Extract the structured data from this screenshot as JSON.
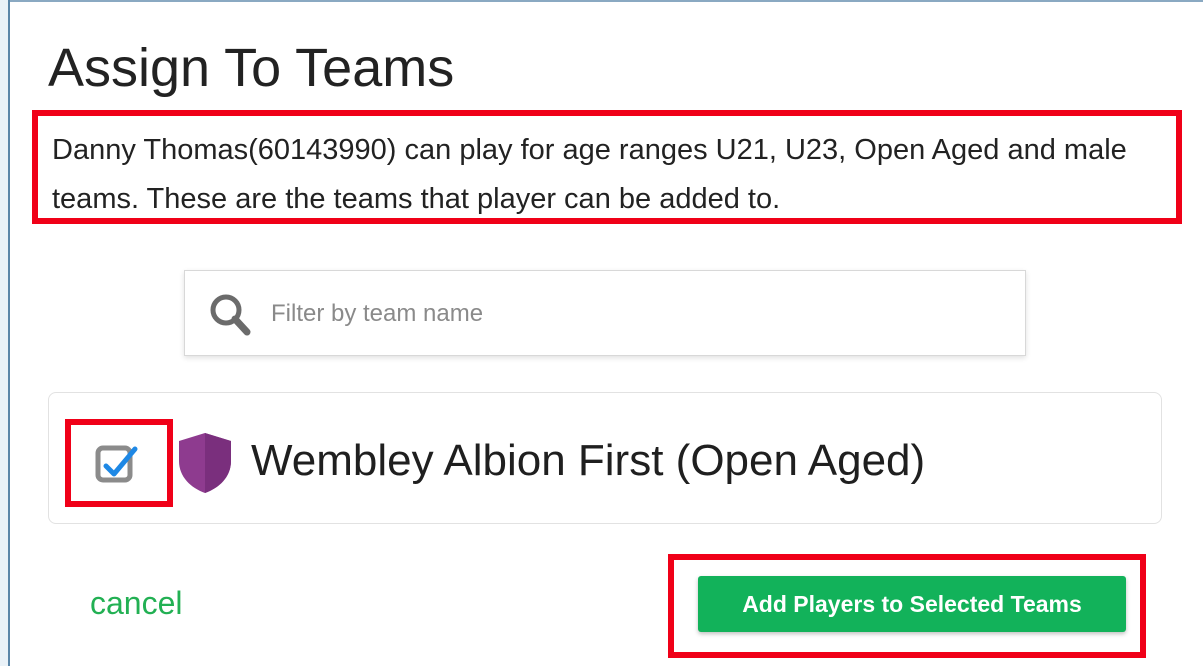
{
  "dialog": {
    "title": "Assign To Teams",
    "description": "Danny Thomas(60143990) can play for age ranges U21, U23, Open Aged and male teams. These are the teams that player can be added to."
  },
  "search": {
    "placeholder": "Filter by team name",
    "value": "",
    "icon": "search-icon"
  },
  "teams": [
    {
      "name": "Wembley Albion First (Open Aged)",
      "checked": true,
      "icon": "shield-icon",
      "shield_color": "#8e3b8f"
    }
  ],
  "actions": {
    "cancel_label": "cancel",
    "add_label": "Add Players to Selected Teams"
  },
  "colors": {
    "accent_green": "#12b25a",
    "cancel_green": "#22b053",
    "highlight_red": "#f00018",
    "check_blue": "#1e88e5"
  }
}
